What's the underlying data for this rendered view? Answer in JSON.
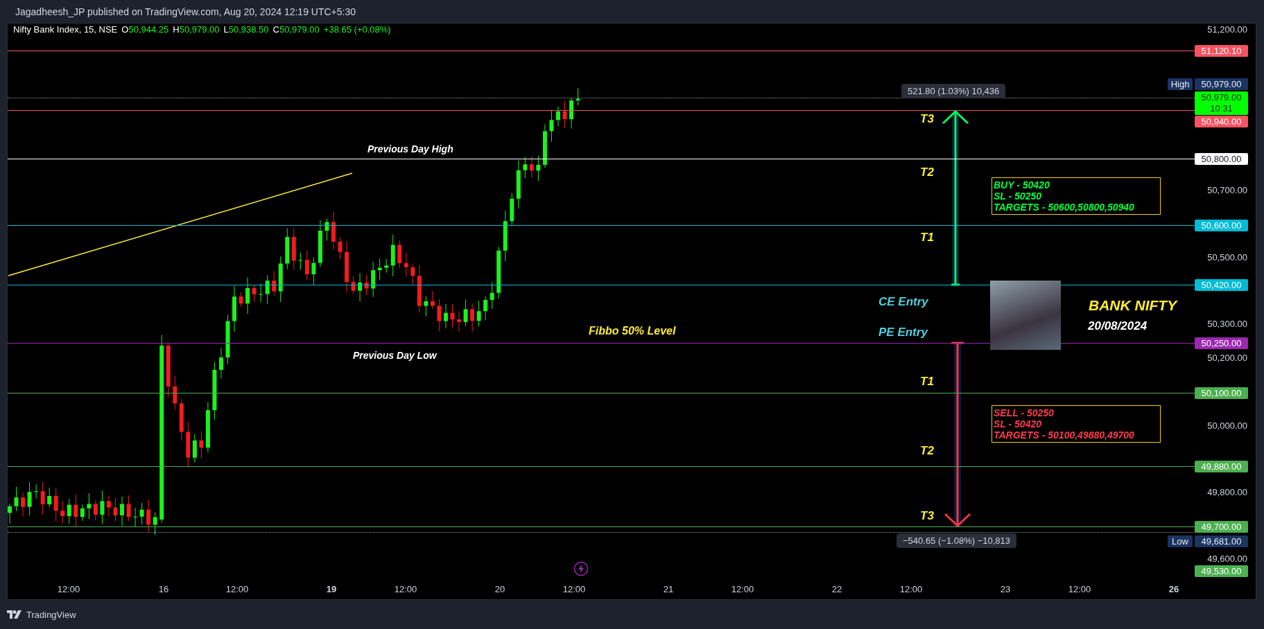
{
  "publish_line": "Jagadheesh_JP published on TradingView.com, Aug 20, 2024 12:19 UTC+5:30",
  "legend": {
    "symbol": "Nifty Bank Index, 15, NSE",
    "values": [
      {
        "key": "O",
        "value": "50,944.25"
      },
      {
        "key": "H",
        "value": "50,979.00"
      },
      {
        "key": "L",
        "value": "50,938.50"
      },
      {
        "key": "C",
        "value": "50,979.00"
      }
    ],
    "change": "+38.65 (+0.08%)"
  },
  "levels": [
    {
      "label": "51,120.10",
      "color": "#f7525f",
      "kind": "line"
    },
    {
      "label": "50,940.00",
      "color": "#f7525f",
      "kind": "line"
    },
    {
      "label": "50,800.00",
      "color": "#ffffff",
      "kind": "line"
    },
    {
      "label": "50,600.00",
      "color": "#00bcd4",
      "kind": "line"
    },
    {
      "label": "50,420.00",
      "color": "#00bcd4",
      "kind": "line"
    },
    {
      "label": "50,250.00",
      "color": "#9c27b0",
      "kind": "line"
    },
    {
      "label": "50,100.00",
      "color": "#4caf50",
      "kind": "line"
    },
    {
      "label": "49,880.00",
      "color": "#4caf50",
      "kind": "line"
    },
    {
      "label": "49,700.00",
      "color": "#4caf50",
      "kind": "line"
    },
    {
      "label": "49,530.00",
      "color": "#4caf50",
      "kind": "tag"
    }
  ],
  "price_ticks": [
    "51,200.00",
    "50,700.00",
    "50,500.00",
    "50,300.00",
    "50,200.00",
    "50,000.00",
    "49,800.00",
    "49,600.00"
  ],
  "high_tag": {
    "tag": "High",
    "value": "50,979.00"
  },
  "last_price": {
    "value": "50,979.00",
    "countdown": "10:31"
  },
  "low_tag": {
    "tag": "Low",
    "value": "49,681.00"
  },
  "annotations": [
    {
      "text": "Previous Day High",
      "color": "#ffffff"
    },
    {
      "text": "Previous Day Low",
      "color": "#ffffff"
    },
    {
      "text": "Fibbo 50% Level",
      "color": "#ffeb3b"
    },
    {
      "text": "T3",
      "color": "#ffeb3b"
    },
    {
      "text": "T2",
      "color": "#ffeb3b"
    },
    {
      "text": "T1",
      "color": "#ffeb3b"
    },
    {
      "text": "CE Entry",
      "color": "#4dd0e1"
    },
    {
      "text": "PE Entry",
      "color": "#4dd0e1"
    },
    {
      "text": "T1",
      "color": "#ffeb3b"
    },
    {
      "text": "T2",
      "color": "#ffeb3b"
    },
    {
      "text": "T3",
      "color": "#ffeb3b"
    },
    {
      "text": "BANK NIFTY",
      "color": "#ffeb3b"
    },
    {
      "text": "20/08/2024",
      "color": "#ffffff"
    }
  ],
  "measures": [
    {
      "kind": "up",
      "text": "521.80 (1.03%) 10,436"
    },
    {
      "kind": "down",
      "text": "−540.65 (−1.08%) −10,813"
    }
  ],
  "signal_boxes": [
    {
      "kind": "buy",
      "lines": [
        "BUY - 50420",
        "SL - 50250",
        "TARGETS - 50600,50800,50940"
      ]
    },
    {
      "kind": "sell",
      "lines": [
        "SELL - 50250",
        "SL - 50420",
        "TARGETS - 50100,49880,49700"
      ]
    }
  ],
  "time_axis": [
    {
      "label": "12:00",
      "bold": false
    },
    {
      "label": "16",
      "bold": false
    },
    {
      "label": "12:00",
      "bold": false
    },
    {
      "label": "19",
      "bold": true
    },
    {
      "label": "12:00",
      "bold": false
    },
    {
      "label": "20",
      "bold": false
    },
    {
      "label": "12:00",
      "bold": false
    },
    {
      "label": "21",
      "bold": false
    },
    {
      "label": "12:00",
      "bold": false
    },
    {
      "label": "22",
      "bold": false
    },
    {
      "label": "12:00",
      "bold": false
    },
    {
      "label": "23",
      "bold": false
    },
    {
      "label": "12:00",
      "bold": false
    },
    {
      "label": "26",
      "bold": true
    }
  ],
  "footer": {
    "brand": "TradingView"
  }
}
